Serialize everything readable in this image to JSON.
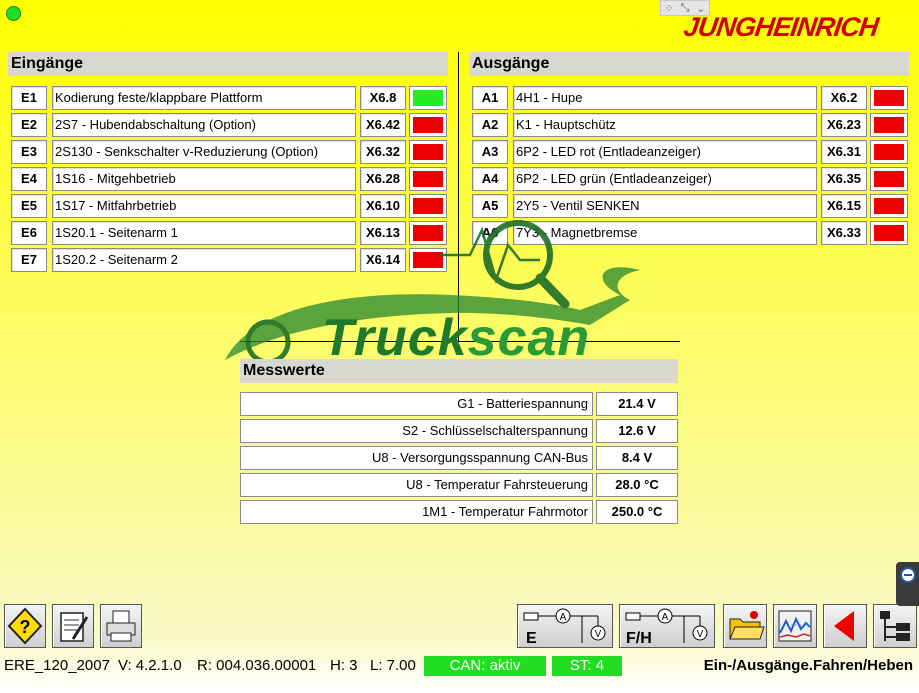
{
  "brand": "JUNGHEINRICH",
  "inputs": {
    "title": "Eingänge",
    "rows": [
      {
        "code": "E1",
        "label": "Kodierung feste/klappbare Plattform",
        "pin": "X6.8",
        "state": "green"
      },
      {
        "code": "E2",
        "label": "2S7 - Hubendabschaltung (Option)",
        "pin": "X6.42",
        "state": "red"
      },
      {
        "code": "E3",
        "label": "2S130 - Senkschalter v-Reduzierung (Option)",
        "pin": "X6.32",
        "state": "red"
      },
      {
        "code": "E4",
        "label": "1S16 - Mitgehbetrieb",
        "pin": "X6.28",
        "state": "red"
      },
      {
        "code": "E5",
        "label": "1S17 - Mitfahrbetrieb",
        "pin": "X6.10",
        "state": "red"
      },
      {
        "code": "E6",
        "label": "1S20.1 - Seitenarm 1",
        "pin": "X6.13",
        "state": "red"
      },
      {
        "code": "E7",
        "label": "1S20.2 - Seitenarm 2",
        "pin": "X6.14",
        "state": "red"
      }
    ]
  },
  "outputs": {
    "title": "Ausgänge",
    "rows": [
      {
        "code": "A1",
        "label": "4H1 - Hupe",
        "pin": "X6.2",
        "state": "red"
      },
      {
        "code": "A2",
        "label": "K1 - Hauptschütz",
        "pin": "X6.23",
        "state": "red"
      },
      {
        "code": "A3",
        "label": "6P2 - LED rot (Entladeanzeiger)",
        "pin": "X6.31",
        "state": "red"
      },
      {
        "code": "A4",
        "label": "6P2 - LED grün (Entladeanzeiger)",
        "pin": "X6.35",
        "state": "red"
      },
      {
        "code": "A5",
        "label": "2Y5 - Ventil SENKEN",
        "pin": "X6.15",
        "state": "red"
      },
      {
        "code": "A6",
        "label": "7Y3 - Magnetbremse",
        "pin": "X6.33",
        "state": "red"
      }
    ]
  },
  "measurements": {
    "title": "Messwerte",
    "rows": [
      {
        "label": "G1 - Batteriespannung",
        "value": "21.4 V"
      },
      {
        "label": "S2 - Schlüsselschalterspannung",
        "value": "12.6 V"
      },
      {
        "label": "U8 - Versorgungsspannung CAN-Bus",
        "value": "8.4 V"
      },
      {
        "label": "U8 - Temperatur Fahrsteuerung",
        "value": "28.0 °C"
      },
      {
        "label": "1M1 - Temperatur Fahrmotor",
        "value": "250.0 °C"
      }
    ]
  },
  "watermark": {
    "part1": "Truck",
    "part2": "scan"
  },
  "toolbar": {
    "left": [
      {
        "name": "help-button",
        "icon": "help-diamond-icon"
      },
      {
        "name": "notes-button",
        "icon": "notepad-pen-icon"
      },
      {
        "name": "print-button",
        "icon": "printer-icon"
      }
    ],
    "right": [
      {
        "name": "inputs-view-button",
        "icon": "circuit-e-icon",
        "label": "E"
      },
      {
        "name": "drive-lift-view-button",
        "icon": "circuit-fh-icon",
        "label": "F/H"
      },
      {
        "name": "open-folder-button",
        "icon": "folder-icon"
      },
      {
        "name": "oscilloscope-button",
        "icon": "graph-icon"
      },
      {
        "name": "back-button",
        "icon": "back-arrow-icon"
      },
      {
        "name": "tree-menu-button",
        "icon": "tree-icon"
      }
    ]
  },
  "status": {
    "ecu": "ERE_120_2007",
    "version": "V: 4.2.1.0",
    "release": "R: 004.036.00001",
    "hw": "H: 3",
    "level": "L: 7.00",
    "can": "CAN: aktiv",
    "st": "ST: 4",
    "screen_title": "Ein-/Ausgänge.Fahren/Heben"
  },
  "colors": {
    "led_green": "#22ee22",
    "led_red": "#ee0000",
    "status_green": "#22dd22",
    "brand_red": "#d00000"
  }
}
